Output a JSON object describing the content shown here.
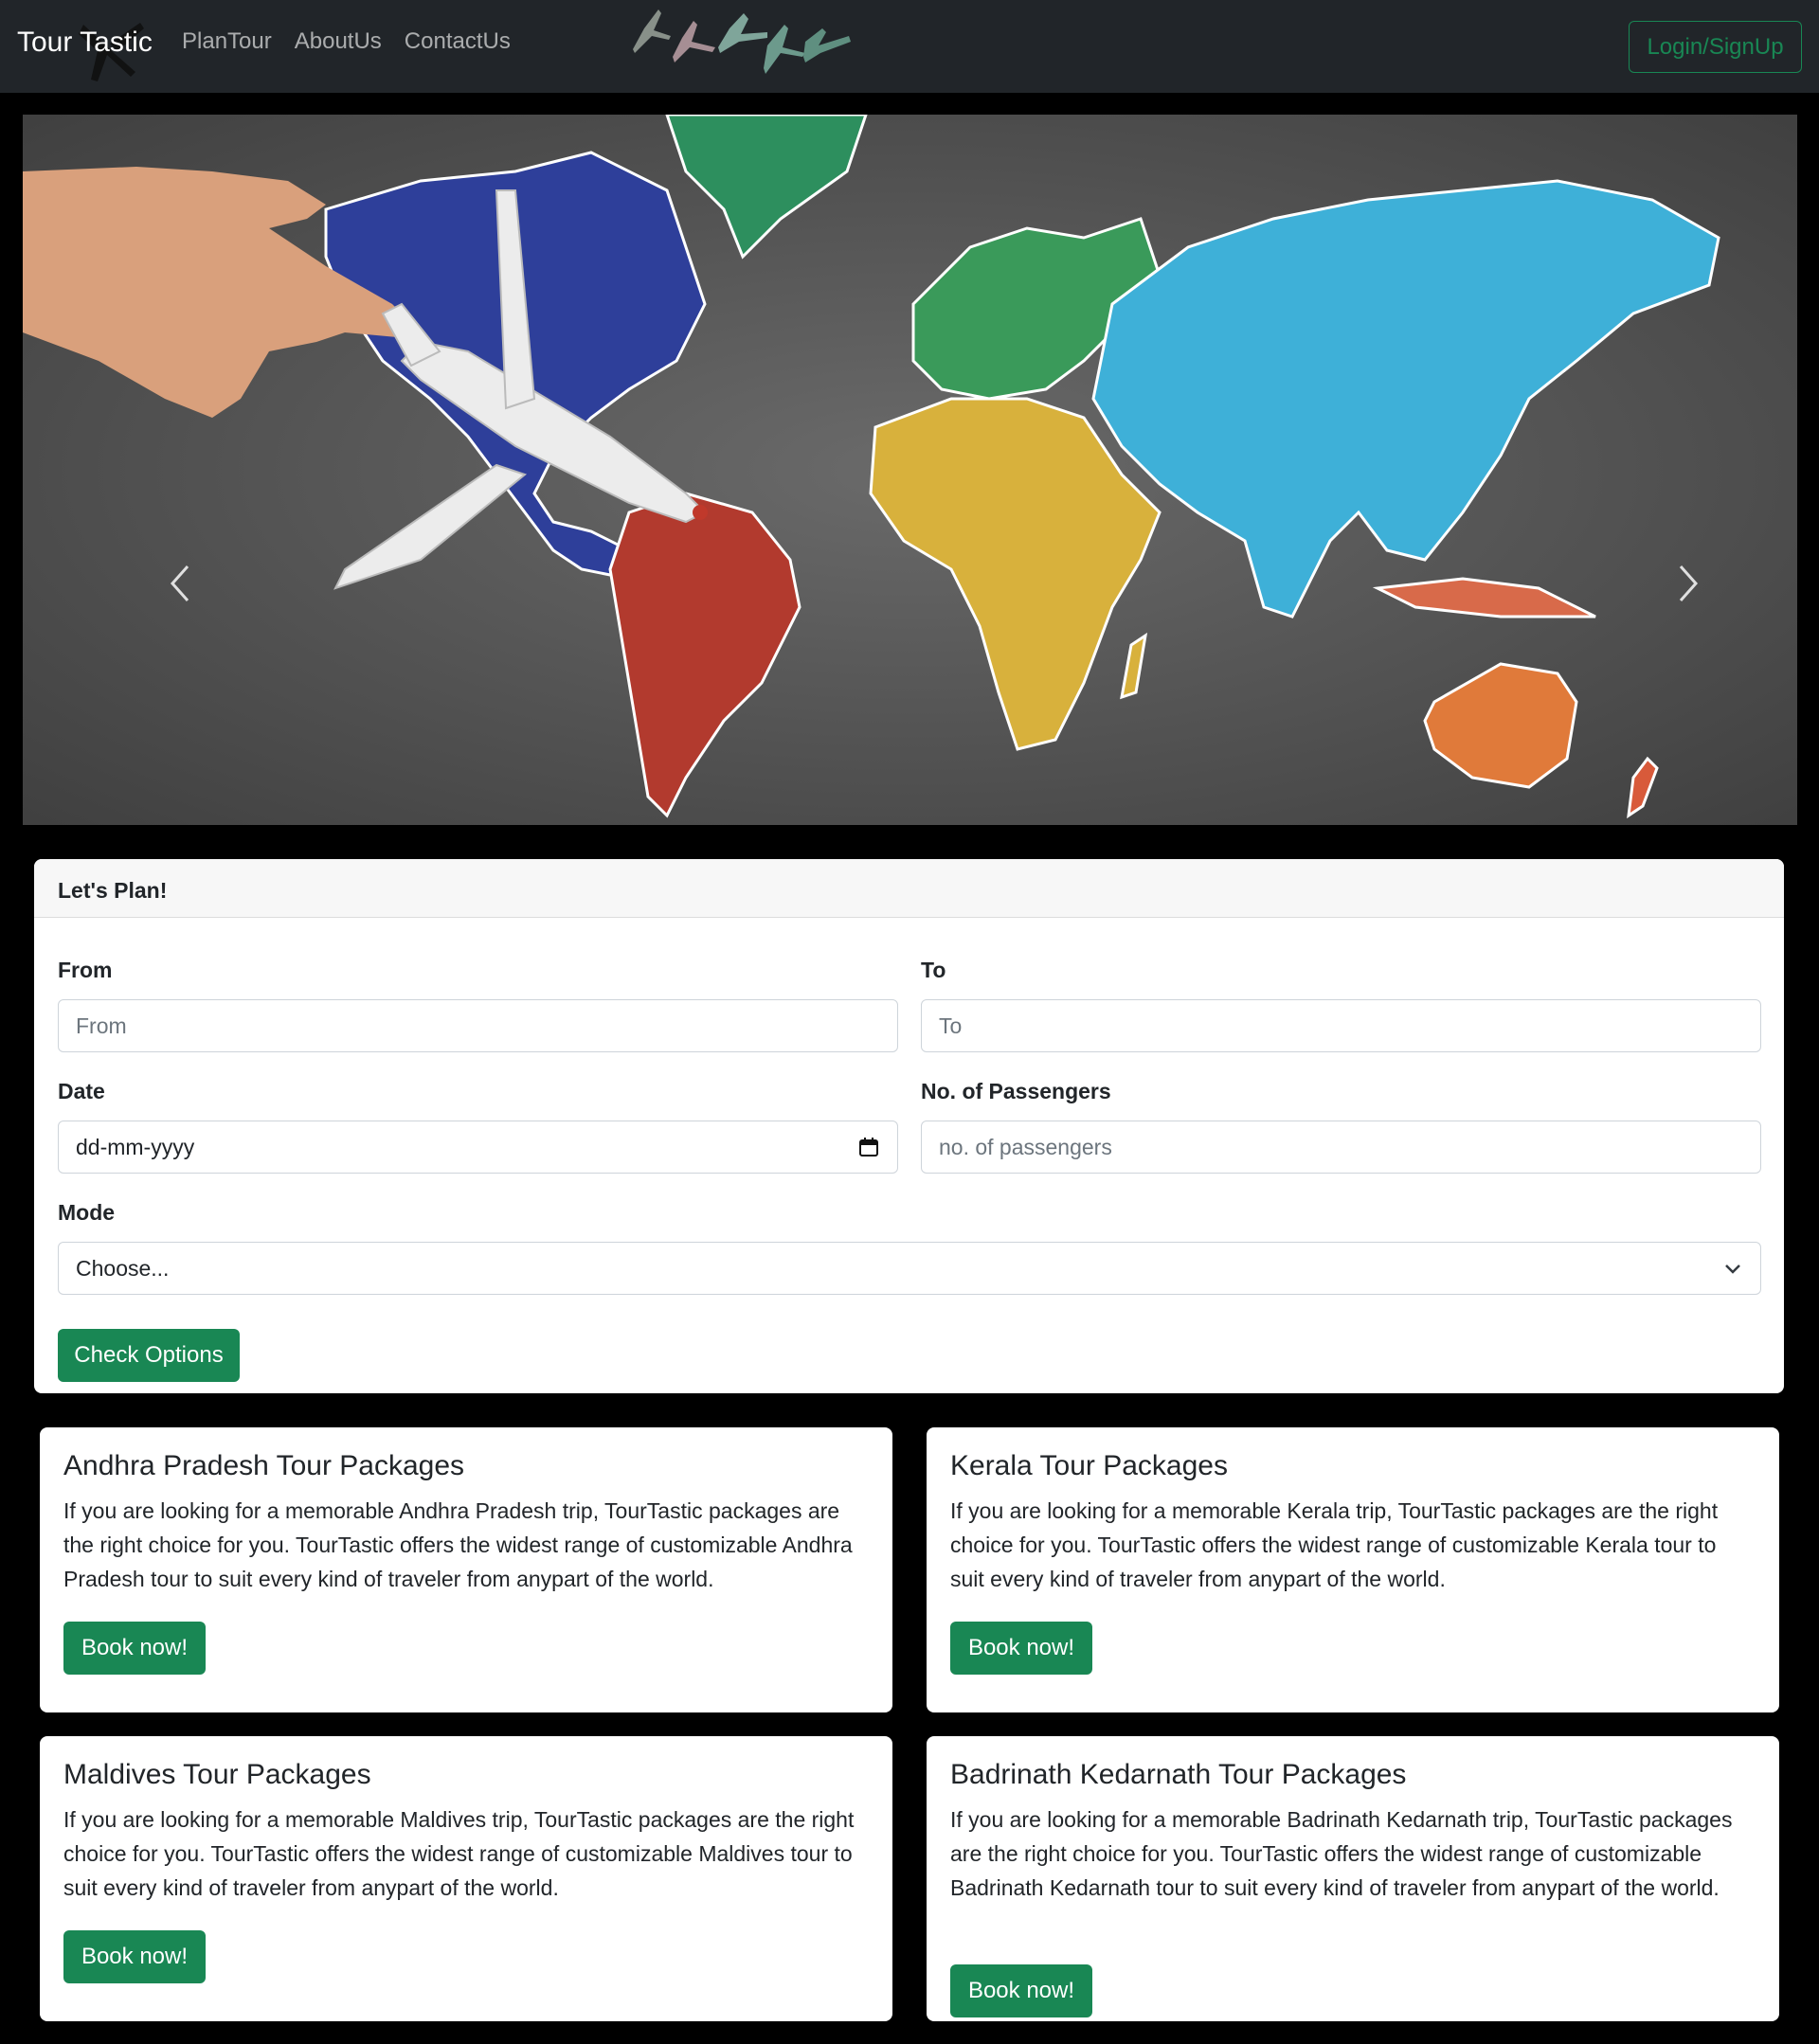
{
  "navbar": {
    "brand": "Tour Tastic",
    "links": [
      "PlanTour",
      "AboutUs",
      "ContactUs"
    ],
    "login_label": "Login/SignUp"
  },
  "carousel": {
    "prev_icon": "chevron-left-icon",
    "next_icon": "chevron-right-icon"
  },
  "plan": {
    "header": "Let's Plan!",
    "from_label": "From",
    "from_placeholder": "From",
    "to_label": "To",
    "to_placeholder": "To",
    "date_label": "Date",
    "date_value": "dd-mm-yyyy",
    "passengers_label": "No. of Passengers",
    "passengers_placeholder": "no. of passengers",
    "mode_label": "Mode",
    "mode_value": "Choose...",
    "submit_label": "Check Options"
  },
  "packages": [
    {
      "title": "Andhra Pradesh Tour Packages",
      "text": "If you are looking for a memorable Andhra Pradesh trip, TourTastic packages are the right choice for you. TourTastic offers the widest range of customizable Andhra Pradesh tour to suit every kind of traveler from anypart of the world.",
      "button": "Book now!"
    },
    {
      "title": "Kerala Tour Packages",
      "text": "If you are looking for a memorable Kerala trip, TourTastic packages are the right choice for you. TourTastic offers the widest range of customizable Kerala tour to suit every kind of traveler from anypart of the world.",
      "button": "Book now!"
    },
    {
      "title": "Maldives Tour Packages",
      "text": "If you are looking for a memorable Maldives trip, TourTastic packages are the right choice for you. TourTastic offers the widest range of customizable Maldives tour to suit every kind of traveler from anypart of the world.",
      "button": "Book now!"
    },
    {
      "title": "Badrinath Kedarnath Tour Packages",
      "text": "If you are looking for a memorable Badrinath Kedarnath trip, TourTastic packages are the right choice for you. TourTastic offers the widest range of customizable Badrinath Kedarnath tour to suit every kind of traveler from anypart of the world.",
      "button": "Book now!"
    }
  ],
  "colors": {
    "navbar_bg": "#212529",
    "accent_green": "#198754",
    "page_bg": "#000000"
  }
}
